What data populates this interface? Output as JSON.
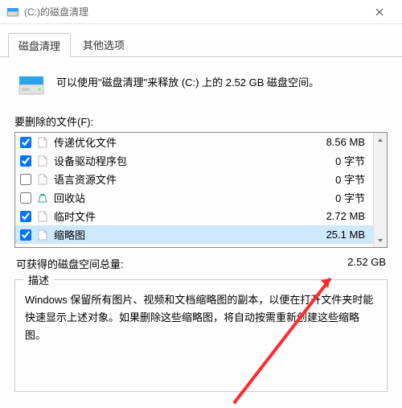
{
  "titlebar": {
    "title": "(C:)的磁盘清理"
  },
  "tabs": {
    "items": [
      "磁盘清理",
      "其他选项"
    ],
    "active": 0
  },
  "intro": {
    "text": "可以使用\"磁盘清理\"来释放  (C:) 上的 2.52 GB 磁盘空间。"
  },
  "list": {
    "label": "要删除的文件(F):",
    "items": [
      {
        "checked": true,
        "icon": "file",
        "name": "传递优化文件",
        "size": "8.56 MB"
      },
      {
        "checked": true,
        "icon": "file",
        "name": "设备驱动程序包",
        "size": "0 字节"
      },
      {
        "checked": false,
        "icon": "file",
        "name": "语言资源文件",
        "size": "0 字节"
      },
      {
        "checked": false,
        "icon": "recycle",
        "name": "回收站",
        "size": "0 字节"
      },
      {
        "checked": true,
        "icon": "file",
        "name": "临时文件",
        "size": "2.72 MB"
      },
      {
        "checked": true,
        "icon": "file",
        "name": "缩略图",
        "size": "25.1 MB"
      }
    ],
    "selected_index": 5
  },
  "total": {
    "label": "可获得的磁盘空间总量:",
    "value": "2.52 GB"
  },
  "description": {
    "legend": "描述",
    "text": "Windows 保留所有图片、视频和文档缩略图的副本，以便在打开文件夹时能快速显示上述对象。如果删除这些缩略图，将自动按需重新创建这些缩略图。"
  }
}
